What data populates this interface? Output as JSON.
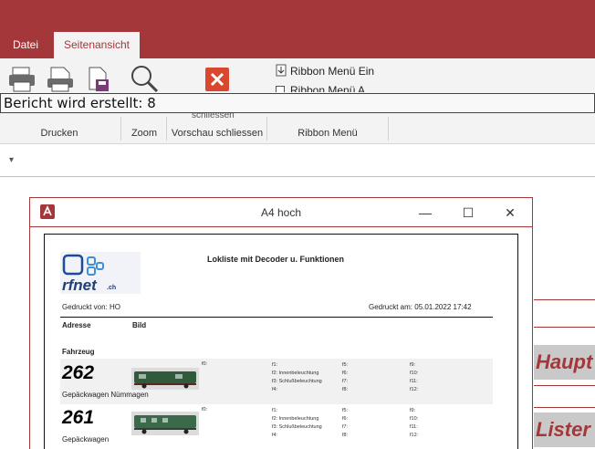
{
  "tabs": [
    {
      "label": "Datei",
      "active": false
    },
    {
      "label": "Seitenansicht",
      "active": true
    }
  ],
  "ribbon": {
    "groups": [
      "Drucken",
      "Zoom",
      "Vorschau schliessen",
      "Ribbon Menü"
    ],
    "ribbon_menu_item": "Ribbon Menü Ein",
    "ribbon_menu_item_2": "Ribbon Menü A",
    "close_preview_partial": "schliessen"
  },
  "status": "Bericht wird erstellt: 8",
  "report_window": {
    "title": "A4 hoch",
    "report_title": "Lokliste mit Decoder u. Funktionen",
    "logo_text": "rfnet",
    "logo_suffix": ".ch",
    "printed_by": "Gedruckt von: HO",
    "printed_at": "Gedruckt am: 05.01.2022 17:42",
    "col_address": "Adresse",
    "col_image": "Bild",
    "section": "Fahrzeug",
    "records": [
      {
        "address": "262",
        "name": "Gepäckwagen Nümmagen",
        "functions": [
          "f0:",
          "f1:",
          "f2: Innenbeleuchtung",
          "f3: Schlußbeleuchtung",
          "f4:",
          "f5:",
          "f6:",
          "f7:",
          "f8:",
          "f9:",
          "f10:",
          "f11:",
          "f12:"
        ]
      },
      {
        "address": "261",
        "name": "Gepäckwagen",
        "functions": [
          "f0:",
          "f1:",
          "f2: Innenbeleuchtung",
          "f3: Schlußbeleuchtung",
          "f4:",
          "f5:",
          "f6:",
          "f7:",
          "f8:",
          "f9:",
          "f10:",
          "f11:",
          "f12:"
        ]
      }
    ]
  },
  "side_buttons": [
    "Haupt",
    "Lister"
  ],
  "colors": {
    "accent": "#a4373a",
    "ribbon": "#f3f3f3",
    "close": "#d9472f"
  }
}
